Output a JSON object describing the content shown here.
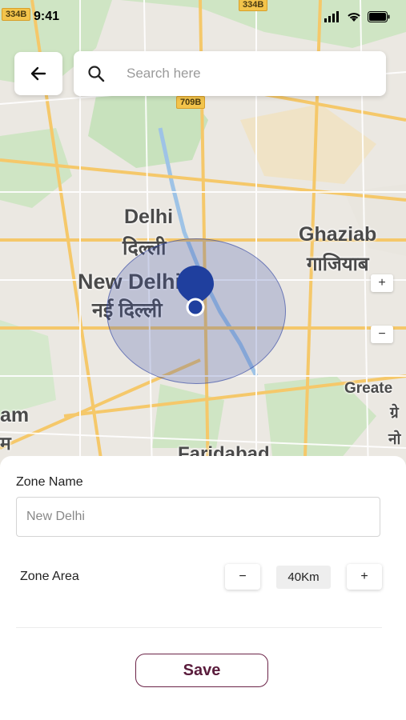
{
  "status_bar": {
    "time": "9:41"
  },
  "search": {
    "placeholder": "Search here"
  },
  "map": {
    "labels": {
      "delhi": "Delhi",
      "delhi_hi": "दिल्ली",
      "new_delhi": "New Delhi",
      "new_delhi_hi": "नई दिल्ली",
      "ghaziabad": "Ghaziab",
      "ghaziabad_hi": "गाजियाब",
      "greater": "Greate",
      "greater_hi": "ग्रे",
      "greater_hi2": "नो",
      "gurugram": "am",
      "gurugram_hi": "म",
      "faridabad": "Faridabad"
    },
    "road_badges": {
      "r1": "334B",
      "r2": "334B",
      "r3": "709B"
    },
    "zoom_in": "+",
    "zoom_out": "−",
    "accent_color": "#1f3f9e"
  },
  "form": {
    "zone_name_label": "Zone Name",
    "zone_name_placeholder": "New Delhi",
    "zone_area_label": "Zone Area",
    "decrement": "−",
    "increment": "+",
    "area_value": "40Km",
    "save_label": "Save"
  }
}
